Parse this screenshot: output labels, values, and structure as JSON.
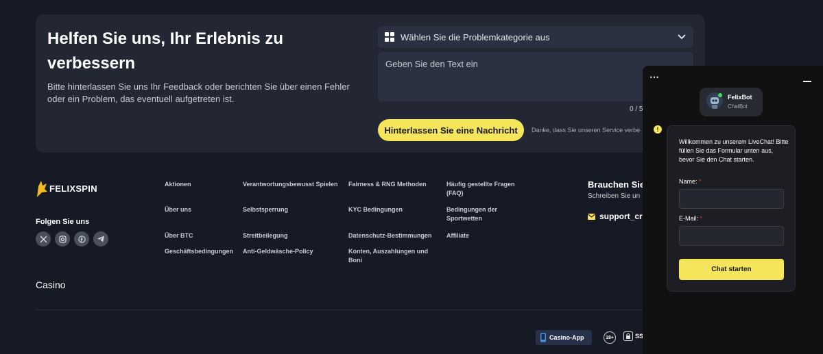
{
  "feedback": {
    "title": "Helfen Sie uns, Ihr Erlebnis zu verbessern",
    "description": "Bitte hinterlassen Sie uns Ihr Feedback oder berichten Sie über einen Fehler oder ein Problem, das eventuell aufgetreten ist.",
    "category_placeholder": "Wählen Sie die Problemkategorie aus",
    "text_placeholder": "Geben Sie den Text ein",
    "char_count": "0 / 5",
    "submit_label": "Hinterlassen Sie eine Nachricht",
    "thanks_text": "Danke, dass Sie unseren Service verbe"
  },
  "footer": {
    "logo_text": "FELIXSPIN",
    "follow_label": "Folgen Sie uns",
    "socials": [
      "x-icon",
      "instagram-icon",
      "facebook-icon",
      "telegram-icon"
    ],
    "links": {
      "col1": [
        "Aktionen",
        "Über uns",
        "Über BTC",
        "Geschäftsbedingungen"
      ],
      "col2": [
        "Verantwortungsbewusst Spielen",
        "Selbstsperrung",
        "Streitbeilegung",
        "Anti-Geldwäsche-Policy"
      ],
      "col3": [
        "Fairness & RNG Methoden",
        "KYC Bedingungen",
        "Datenschutz-Bestimmungen",
        "Konten, Auszahlungen und Boni"
      ],
      "col4": [
        "Häufig gestellte Fragen (FAQ)",
        "Bedingungen der Sportwetten",
        "Affiliate"
      ]
    },
    "help_title": "Brauchen Sie",
    "help_sub": "Schreiben Sie un",
    "support_email": "support_cr",
    "casino_heading": "Casino",
    "app_badge": "Casino-App",
    "age_badge": "18+",
    "ssl_badge": "SS"
  },
  "chat": {
    "menu_icon": "⋯",
    "bot_name": "FelixBot",
    "bot_role": "ChatBot",
    "welcome": "Willkommen zu unserem LiveChat! Bitte füllen Sie das Formular unten aus, bevor Sie den Chat starten.",
    "name_label": "Name:",
    "email_label": "E-Mail:",
    "required_mark": "*",
    "name_value": "",
    "email_value": "",
    "start_label": "Chat starten"
  },
  "colors": {
    "background": "#161a24",
    "card": "#222733",
    "accent": "#f4e55b",
    "required": "#e0393e"
  }
}
